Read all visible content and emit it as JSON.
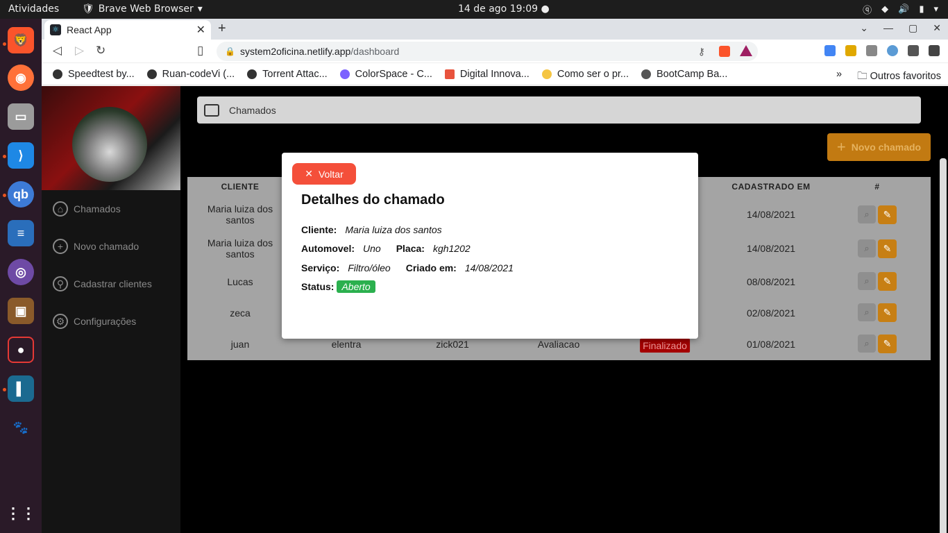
{
  "os": {
    "activities": "Atividades",
    "app_name": "Brave Web Browser",
    "clock": "14 de ago  19:09"
  },
  "browser": {
    "tab_title": "React App",
    "url_host": "system2oficina.netlify.app",
    "url_path": "/dashboard",
    "bookmarks": [
      "Speedtest by...",
      "Ruan-codeVi (...",
      "Torrent Attac...",
      "ColorSpace - C...",
      "Digital Innova...",
      "Como ser o pr...",
      "BootCamp Ba..."
    ],
    "more_bookmarks": "»",
    "other_favorites": "Outros favoritos"
  },
  "sidebar": {
    "items": [
      {
        "label": "Chamados",
        "icon": "home-icon"
      },
      {
        "label": "Novo chamado",
        "icon": "plus-circle-icon"
      },
      {
        "label": "Cadastrar clientes",
        "icon": "user-icon"
      },
      {
        "label": "Configurações",
        "icon": "gear-icon"
      }
    ]
  },
  "header": {
    "title": "Chamados"
  },
  "actions": {
    "new_ticket": "Novo chamado"
  },
  "table": {
    "headers": {
      "cliente": "CLIENTE",
      "cadastrado": "CADASTRADO EM",
      "acoes": "#"
    },
    "rows": [
      {
        "cliente": "Maria luiza dos santos",
        "cadastrado": "14/08/2021"
      },
      {
        "cliente": "Maria luiza dos santos",
        "cadastrado": "14/08/2021"
      },
      {
        "cliente": "Lucas",
        "cadastrado": "08/08/2021"
      },
      {
        "cliente": "zeca",
        "cadastrado": "02/08/2021"
      },
      {
        "cliente": "juan",
        "automovel": "elentra",
        "placa": "zick021",
        "servico": "Avaliacao",
        "status": "Finalizado",
        "cadastrado": "01/08/2021"
      }
    ]
  },
  "modal": {
    "back_label": "Voltar",
    "title": "Detalhes do chamado",
    "cliente_label": "Cliente:",
    "cliente": "Maria luiza dos santos",
    "automovel_label": "Automovel:",
    "automovel": "Uno",
    "placa_label": "Placa:",
    "placa": "kgh1202",
    "servico_label": "Serviço:",
    "servico": "Filtro/óleo",
    "criado_label": "Criado em:",
    "criado": "14/08/2021",
    "status_label": "Status:",
    "status": "Aberto"
  },
  "colors": {
    "accent": "#c27a12",
    "danger": "#f44f3a",
    "success": "#2bb04e",
    "finalizado": "#a40000"
  }
}
